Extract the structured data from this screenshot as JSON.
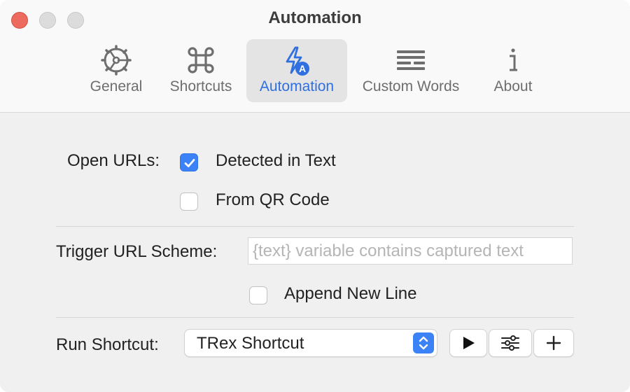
{
  "window": {
    "title": "Automation"
  },
  "tabs": [
    {
      "label": "General",
      "icon": "gear-icon",
      "active": false
    },
    {
      "label": "Shortcuts",
      "icon": "command-icon",
      "active": false
    },
    {
      "label": "Automation",
      "icon": "automation-bolt-icon",
      "active": true
    },
    {
      "label": "Custom Words",
      "icon": "text-lines-icon",
      "active": false
    },
    {
      "label": "About",
      "icon": "info-icon",
      "active": false
    }
  ],
  "open_urls": {
    "label": "Open URLs:",
    "options": [
      {
        "label": "Detected in Text",
        "checked": true
      },
      {
        "label": "From QR Code",
        "checked": false
      }
    ]
  },
  "trigger": {
    "label": "Trigger URL Scheme:",
    "placeholder": "{text} variable contains captured text",
    "value": "",
    "append_label": "Append New Line",
    "append_checked": false
  },
  "run_shortcut": {
    "label": "Run Shortcut:",
    "selected": "TRex Shortcut",
    "buttons": [
      "play-icon",
      "sliders-icon",
      "plus-icon"
    ]
  },
  "colors": {
    "accent": "#3b82f6",
    "tab_active_text": "#2f6fe0",
    "close": "#ec6a5e"
  }
}
